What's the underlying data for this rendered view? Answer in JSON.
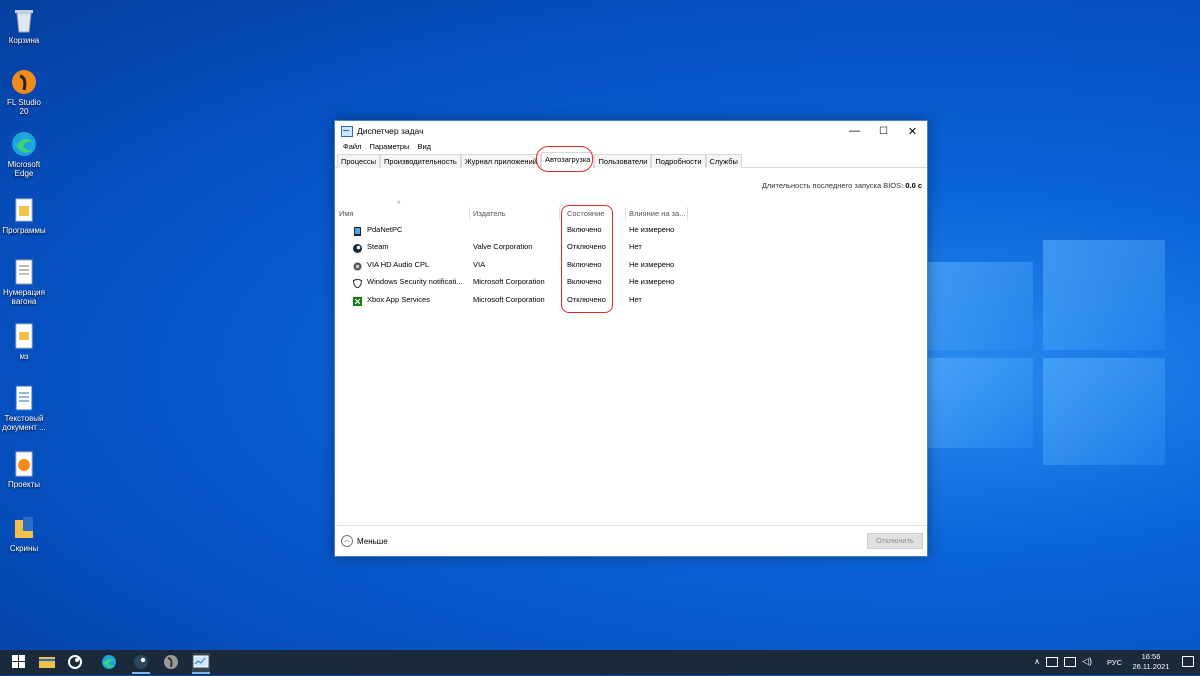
{
  "desktop": {
    "icons": [
      {
        "label": "Корзина"
      },
      {
        "label": "FL Studio 20"
      },
      {
        "label": "Microsoft Edge"
      },
      {
        "label": "Программы"
      },
      {
        "label": "Нумерация вагона"
      },
      {
        "label": "мз"
      },
      {
        "label": "Текстовый документ ..."
      },
      {
        "label": "Проекты"
      },
      {
        "label": "Скрины"
      }
    ]
  },
  "window": {
    "title": "Диспетчер задач",
    "menu": [
      "Файл",
      "Параметры",
      "Вид"
    ],
    "controls": {
      "minimize": "—",
      "maximize": "☐",
      "close": "✕"
    },
    "tabs": [
      "Процессы",
      "Производительность",
      "Журнал приложений",
      "Автозагрузка",
      "Пользователи",
      "Подробности",
      "Службы"
    ],
    "active_tab": "Автозагрузка",
    "bios_label": "Длительность последнего запуска BIOS:",
    "bios_value": "0.0 с",
    "columns": [
      "Имя",
      "Издатель",
      "Состояние",
      "Влияние на за..."
    ],
    "rows": [
      {
        "name": "PdaNetPC",
        "publisher": "",
        "status": "Включено",
        "impact": "Не измерено",
        "icon": "pdanet-icon"
      },
      {
        "name": "Steam",
        "publisher": "Valve Corporation",
        "status": "Отключено",
        "impact": "Нет",
        "icon": "steam-icon"
      },
      {
        "name": "VIA HD Audio CPL",
        "publisher": "VIA",
        "status": "Включено",
        "impact": "Не измерено",
        "icon": "audio-icon"
      },
      {
        "name": "Windows Security notificati...",
        "publisher": "Microsoft Corporation",
        "status": "Включено",
        "impact": "Не измерено",
        "icon": "shield-icon"
      },
      {
        "name": "Xbox App Services",
        "publisher": "Microsoft Corporation",
        "status": "Отключено",
        "impact": "Нет",
        "icon": "xbox-icon"
      }
    ],
    "less_label": "Меньше",
    "disable_button": "Отключить"
  },
  "taskbar": {
    "lang": "РУС",
    "time": "16:56",
    "date": "26.11.2021"
  },
  "colors": {
    "highlight": "#e0282a",
    "accent": "#0a63d8",
    "taskbar": "#1b2a3a"
  }
}
